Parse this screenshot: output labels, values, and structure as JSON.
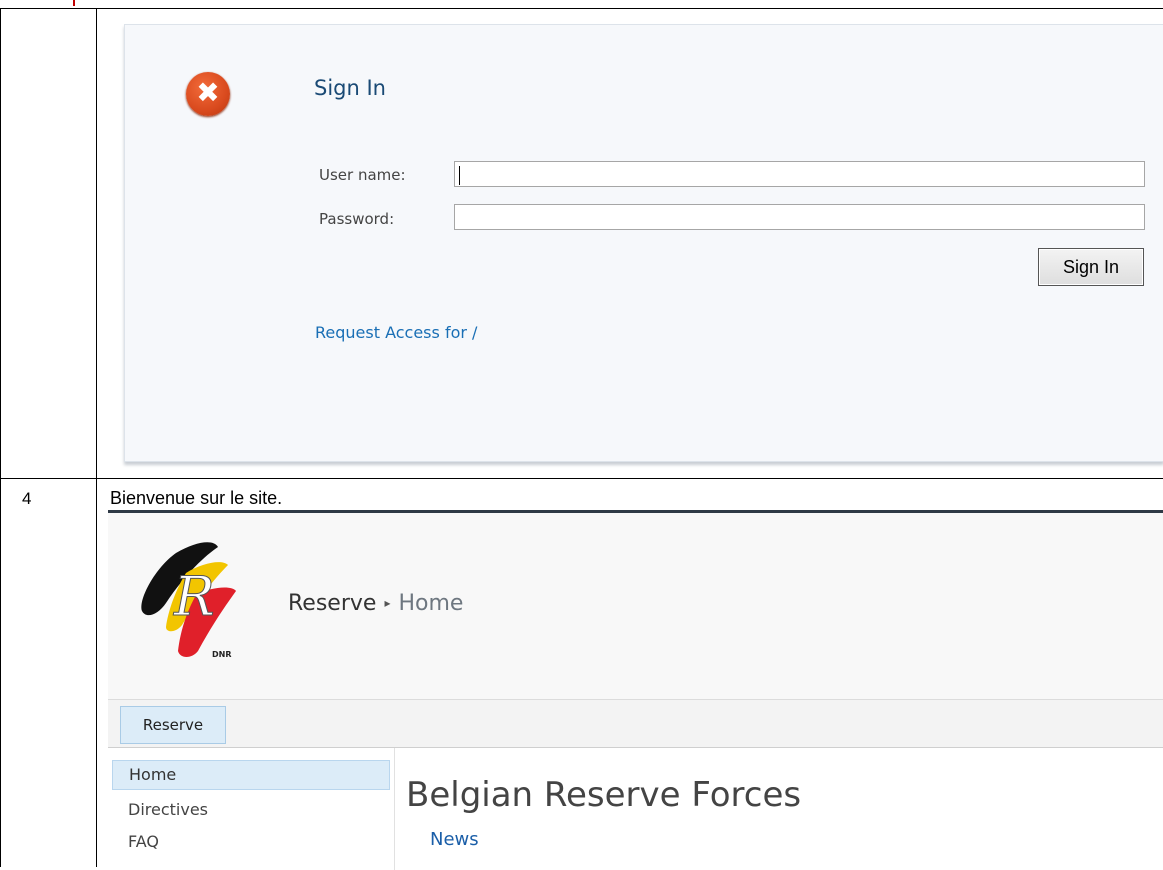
{
  "signin": {
    "title": "Sign In",
    "username_label": "User name:",
    "password_label": "Password:",
    "username_value": "",
    "password_value": "",
    "button_label": "Sign In",
    "request_access_link": "Request Access for /",
    "error_icon_glyph": "✖"
  },
  "row4": {
    "number": "4",
    "text": "Bienvenue sur le site."
  },
  "site": {
    "logo_caption": "DNR",
    "breadcrumb": {
      "site": "Reserve",
      "separator": "▸",
      "page": "Home"
    },
    "top_nav": [
      "Reserve"
    ],
    "quick_launch": [
      "Home",
      "Directives",
      "FAQ"
    ],
    "page_title": "Belgian Reserve Forces",
    "section_heading": "News"
  },
  "colors": {
    "accent_blue": "#1a4a75",
    "link_blue": "#1a6fb5",
    "error_orange": "#d94a1e",
    "selected_bg": "#dcecf8"
  }
}
